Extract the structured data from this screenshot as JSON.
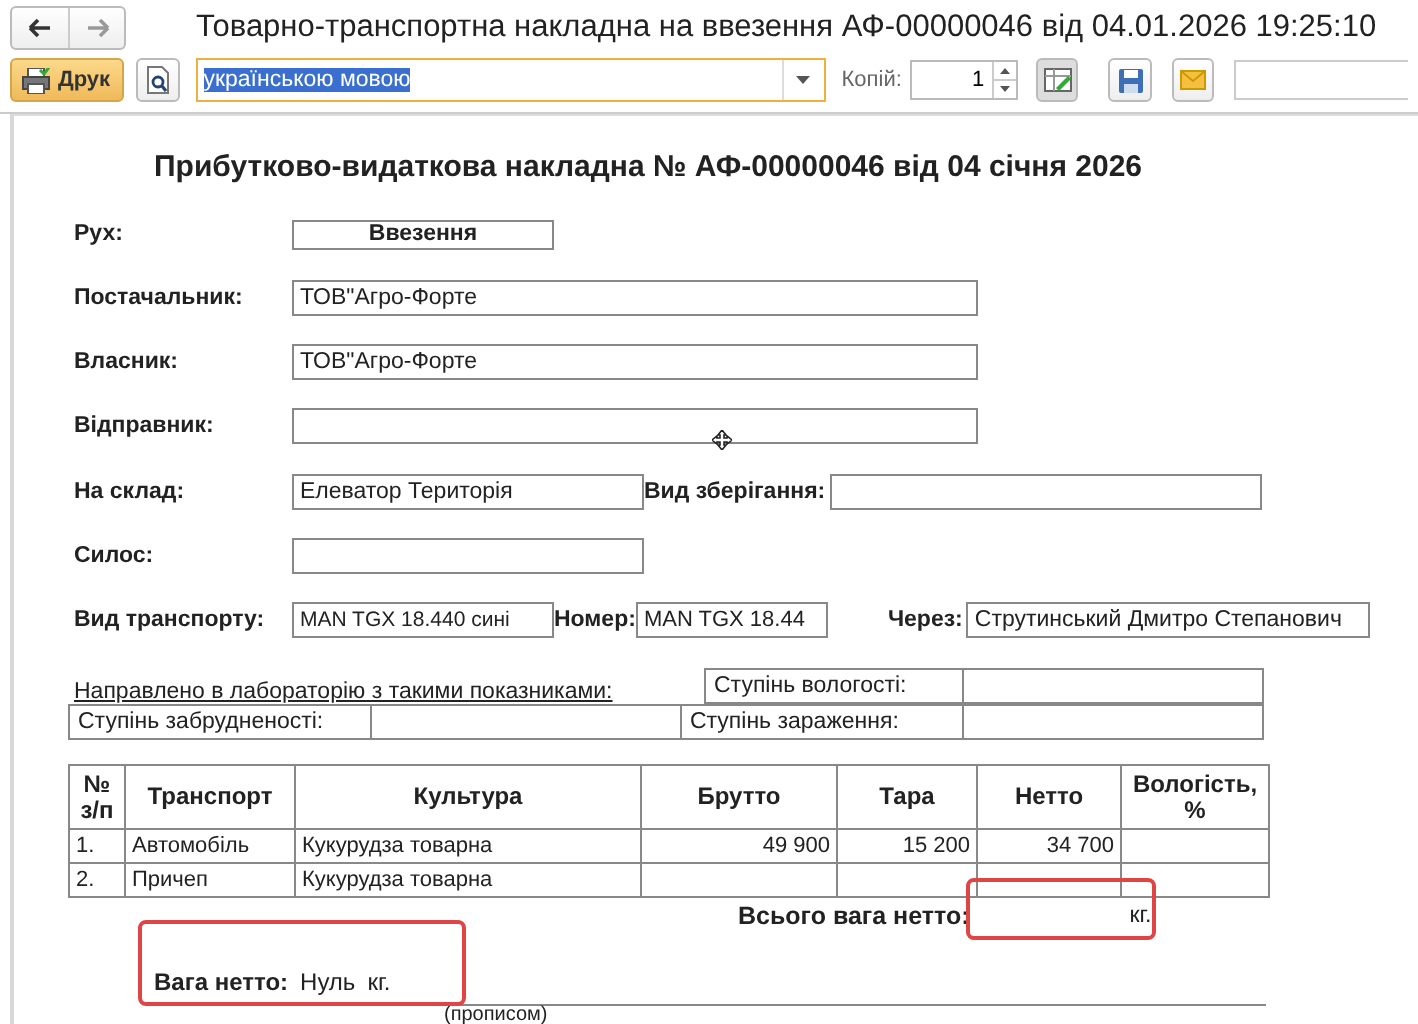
{
  "window": {
    "title": "Товарно-транспортна накладна на ввезення АФ-00000046 від 04.01.2026 19:25:10"
  },
  "toolbar": {
    "print_button": "Друк",
    "language": {
      "value": "українською мовою",
      "text_selected": true
    },
    "copies_label": "Копій:",
    "copies": "1"
  },
  "document": {
    "title": "Прибутково-видаткова накладна № АФ-00000046 від 04 січня 2026",
    "movement": {
      "label": "Рух:",
      "value": "Ввезення"
    },
    "supplier": {
      "label": "Постачальник:",
      "value": "ТОВ\"Агро-Форте"
    },
    "owner": {
      "label": "Власник:",
      "value": "ТОВ\"Агро-Форте"
    },
    "sender": {
      "label": "Відправник:"
    },
    "warehouse": {
      "label": "На склад:",
      "value": "Елеватор Територія"
    },
    "storage_type": {
      "label": "Вид зберігання:"
    },
    "silo": {
      "label": "Силос:"
    },
    "transport_type": {
      "label": "Вид транспорту:",
      "value": "MAN TGX 18.440 сині"
    },
    "number": {
      "label": "Номер:",
      "value": "MAN TGX 18.44"
    },
    "via": {
      "label": "Через:",
      "value": "Струтинський Дмитро Степанович"
    },
    "lab": {
      "sent_text": "Направлено в лабораторію з такими показниками:",
      "moisture": "Ступінь вологості:",
      "impurity": "Ступінь забрудненості:",
      "infection": "Ступінь зараження:"
    },
    "table": {
      "columns": [
        "№ з/п",
        "Транспорт",
        "Культура",
        "Брутто",
        "Тара",
        "Нетто",
        "Вологість, %"
      ],
      "rows": [
        [
          "1.",
          "Автомобіль",
          "Кукурудза товарна",
          "49 900",
          "15 200",
          "34 700",
          ""
        ],
        [
          "2.",
          "Причеп",
          "Кукурудза товарна",
          "",
          "",
          "",
          ""
        ]
      ]
    },
    "total_net": {
      "label": "Всього вага нетто:",
      "unit": "кг.",
      "highlighted": true
    },
    "net_weight": {
      "label": "Вага нетто:",
      "value": "Нуль",
      "unit": "кг.",
      "caption": "(прописом)",
      "highlighted": true
    }
  }
}
